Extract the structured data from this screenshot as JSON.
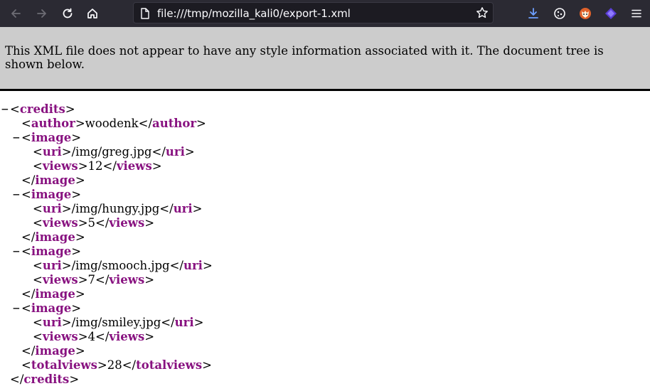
{
  "browser": {
    "url": "file:///tmp/mozilla_kali0/export-1.xml",
    "icons": [
      "back-icon",
      "forward-icon",
      "reload-icon",
      "home-icon",
      "page-icon",
      "bookmark-star-icon",
      "downloads-icon",
      "cookie-extension-icon",
      "fox-extension-icon",
      "purple-extension-icon",
      "menu-icon"
    ],
    "accent": "#6ea0ff"
  },
  "banner": {
    "message": "This XML file does not appear to have any style information associated with it. The document tree is shown below."
  },
  "xml": {
    "root": "credits",
    "author_tag": "author",
    "author": "woodenk",
    "image_tag": "image",
    "uri_tag": "uri",
    "views_tag": "views",
    "collapse_glyph": "−",
    "images": [
      {
        "uri": "/img/greg.jpg",
        "views": "12"
      },
      {
        "uri": "/img/hungy.jpg",
        "views": "5"
      },
      {
        "uri": "/img/smooch.jpg",
        "views": "7"
      },
      {
        "uri": "/img/smiley.jpg",
        "views": "4"
      }
    ],
    "totalviews_tag": "totalviews",
    "totalviews": "28"
  },
  "colors": {
    "toolbar": "#2b2a33",
    "urlbar": "#1c1b22",
    "banner_bg": "#cccccc",
    "tag": "#881280"
  }
}
